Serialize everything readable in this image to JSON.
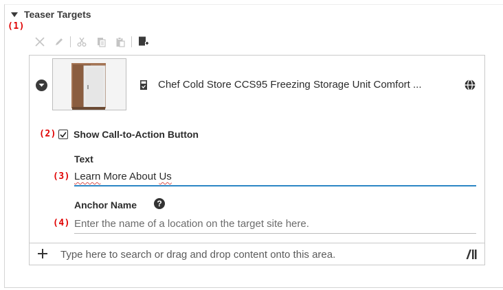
{
  "section": {
    "title": "Teaser Targets"
  },
  "callouts": {
    "c1": "(1)",
    "c2": "(2)",
    "c3": "(3)",
    "c4": "(4)"
  },
  "toolbar": {
    "icons": [
      "close-icon",
      "pencil-icon",
      "cut-icon",
      "copy-icon",
      "paste-icon",
      "add-document-icon"
    ]
  },
  "target": {
    "title": "Chef Cold Store CCS95 Freezing Storage Unit Comfort ...",
    "icons": [
      "collapse-icon",
      "product-thumbnail",
      "document-icon",
      "globe-icon"
    ]
  },
  "cta": {
    "label": "Show Call-to-Action Button",
    "checked": true
  },
  "text_field": {
    "label": "Text",
    "value_word1": "Learn",
    "value_mid": " More About ",
    "value_word2": "Us"
  },
  "anchor_field": {
    "label": "Anchor Name",
    "placeholder": "Enter the name of a location on the target site here."
  },
  "drop_area": {
    "text": "Type here to search or drag and drop content onto this area."
  },
  "colors": {
    "focus_underline": "#2a85c4",
    "callout": "#e00000",
    "disabled_icon": "#c4c4c4"
  }
}
